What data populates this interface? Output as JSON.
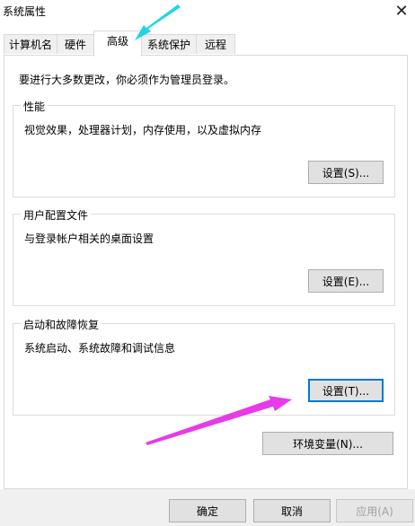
{
  "window": {
    "title": "系统属性"
  },
  "tabs": [
    {
      "label": "计算机名"
    },
    {
      "label": "硬件"
    },
    {
      "label": "高级",
      "active": true
    },
    {
      "label": "系统保护"
    },
    {
      "label": "远程"
    }
  ],
  "notice": "要进行大多数更改，你必须作为管理员登录。",
  "groups": {
    "performance": {
      "title": "性能",
      "desc": "视觉效果，处理器计划，内存使用，以及虚拟内存",
      "button": "设置(S)..."
    },
    "profile": {
      "title": "用户配置文件",
      "desc": "与登录帐户相关的桌面设置",
      "button": "设置(E)..."
    },
    "startup": {
      "title": "启动和故障恢复",
      "desc": "系统启动、系统故障和调试信息",
      "button": "设置(T)..."
    }
  },
  "env_button": "环境变量(N)...",
  "footer": {
    "ok": "确定",
    "cancel": "取消",
    "apply": "应用(A)"
  },
  "colors": {
    "arrow_cyan": "#1fd6e6",
    "arrow_magenta": "#e83be8",
    "focus": "#0078d7"
  }
}
